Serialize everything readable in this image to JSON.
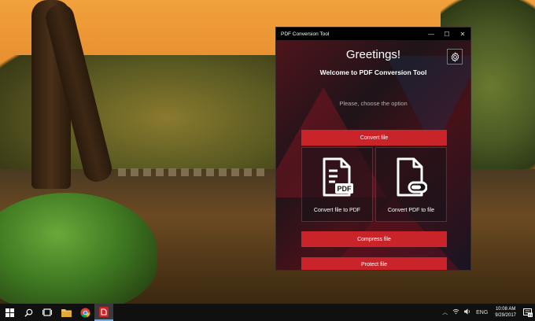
{
  "window": {
    "title": "PDF Conversion Tool",
    "controls": {
      "minimize": "—",
      "maximize": "☐",
      "close": "✕"
    }
  },
  "app": {
    "greeting": "Greetings!",
    "welcome": "Welcome to PDF Conversion Tool",
    "prompt": "Please, choose the option",
    "settings_icon": "gear-icon",
    "buttons": {
      "convert": "Convert file",
      "compress": "Compress file",
      "protect": "Protect file"
    },
    "tiles": [
      {
        "label": "Convert file to PDF",
        "icon": "file-to-pdf-icon",
        "badge": "PDF"
      },
      {
        "label": "Convert PDF to file",
        "icon": "pdf-to-file-icon"
      }
    ],
    "colors": {
      "accent": "#c9242a",
      "background": "#1e1418"
    }
  },
  "taskbar": {
    "items": [
      "windows-start-icon",
      "search-icon",
      "task-view-icon",
      "file-explorer-icon",
      "chrome-icon",
      "pdf-tool-icon"
    ],
    "tray": {
      "language": "ENG",
      "time": "10:08 AM",
      "date": "9/29/2017",
      "notification_count": "21"
    }
  }
}
